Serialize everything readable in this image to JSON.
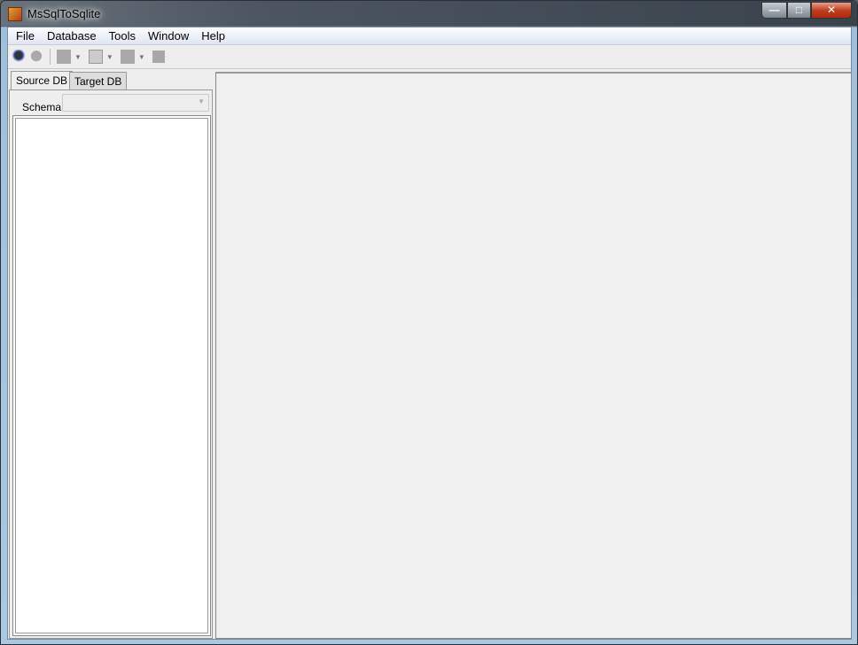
{
  "window": {
    "title": "MsSqlToSqlite",
    "minimize": "—",
    "maximize": "□",
    "close": "✕"
  },
  "menu": [
    "File",
    "Database",
    "Tools",
    "Window",
    "Help"
  ],
  "toolbar": {
    "icons": [
      "connect-icon",
      "disconnect-icon",
      "table-icon",
      "query-icon",
      "export-icon",
      "stop-icon"
    ]
  },
  "left_panel": {
    "tabs": [
      {
        "label": "Source DB",
        "active": true
      },
      {
        "label": "Target DB",
        "active": false
      }
    ],
    "schema_label": "Schema",
    "schema_value": ""
  }
}
